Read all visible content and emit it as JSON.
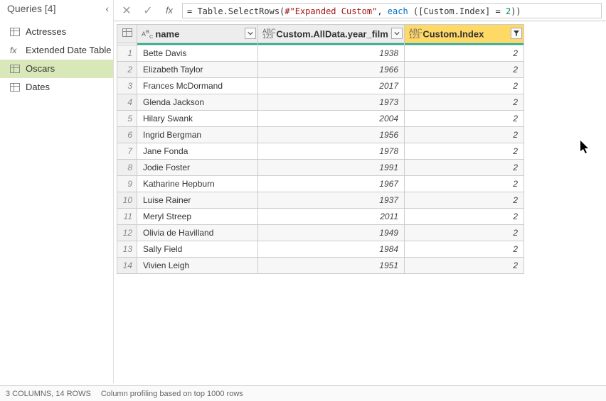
{
  "queriesPanel": {
    "headerLabel": "Queries [4]",
    "items": [
      {
        "label": "Actresses",
        "iconType": "table",
        "selected": false
      },
      {
        "label": "Extended Date Table",
        "iconType": "fx",
        "selected": false
      },
      {
        "label": "Oscars",
        "iconType": "table",
        "selected": true
      },
      {
        "label": "Dates",
        "iconType": "table",
        "selected": false
      }
    ]
  },
  "formula": {
    "prefix": "= Table.SelectRows(",
    "string": "#\"Expanded Custom\"",
    "mid1": ", ",
    "each": "each",
    "mid2": " ([Custom.Index] = ",
    "num": "2",
    "suffix": "))"
  },
  "columns": [
    {
      "name": "name",
      "typeIcon": "AᵇC",
      "filtered": false,
      "widthClass": "col-name-w"
    },
    {
      "name": "Custom.AllData.year_film",
      "typeIcon": "ABC\n123",
      "filtered": false,
      "widthClass": "col-year-w"
    },
    {
      "name": "Custom.Index",
      "typeIcon": "ABC\n123",
      "filtered": true,
      "widthClass": "col-index-w"
    }
  ],
  "rows": [
    {
      "name": "Bette Davis",
      "year": "1938",
      "index": "2"
    },
    {
      "name": "Elizabeth Taylor",
      "year": "1966",
      "index": "2"
    },
    {
      "name": "Frances McDormand",
      "year": "2017",
      "index": "2"
    },
    {
      "name": "Glenda Jackson",
      "year": "1973",
      "index": "2"
    },
    {
      "name": "Hilary Swank",
      "year": "2004",
      "index": "2"
    },
    {
      "name": "Ingrid Bergman",
      "year": "1956",
      "index": "2"
    },
    {
      "name": "Jane Fonda",
      "year": "1978",
      "index": "2"
    },
    {
      "name": "Jodie Foster",
      "year": "1991",
      "index": "2"
    },
    {
      "name": "Katharine Hepburn",
      "year": "1967",
      "index": "2"
    },
    {
      "name": "Luise Rainer",
      "year": "1937",
      "index": "2"
    },
    {
      "name": "Meryl Streep",
      "year": "2011",
      "index": "2"
    },
    {
      "name": "Olivia de Havilland",
      "year": "1949",
      "index": "2"
    },
    {
      "name": "Sally Field",
      "year": "1984",
      "index": "2"
    },
    {
      "name": "Vivien Leigh",
      "year": "1951",
      "index": "2"
    }
  ],
  "statusBar": {
    "colsRows": "3 COLUMNS, 14 ROWS",
    "profiling": "Column profiling based on top 1000 rows"
  }
}
